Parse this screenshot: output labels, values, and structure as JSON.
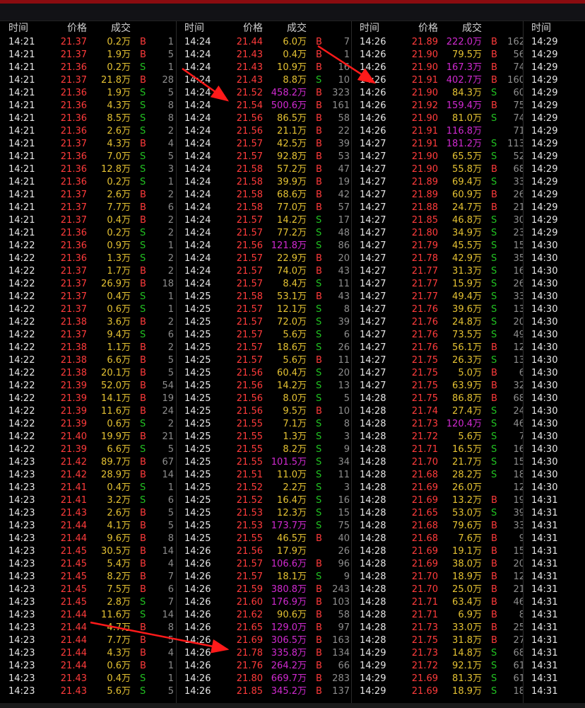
{
  "header": {
    "time": "时间",
    "price": "价格",
    "volume": "成交"
  },
  "colors": {
    "up": "#ff3b3b",
    "down": "#1fbf1f",
    "vol": "#e5c233",
    "vol_big": "#d12ad1",
    "buy": "#ff3b3b",
    "sell": "#22c322",
    "accent_bar": "#8a0c10"
  },
  "columns": [
    {
      "rows": [
        [
          "14:21",
          "21.37",
          "0.2万",
          "B",
          "1"
        ],
        [
          "14:21",
          "21.37",
          "1.9万",
          "B",
          "5"
        ],
        [
          "14:21",
          "21.36",
          "0.2万",
          "S",
          "1"
        ],
        [
          "14:21",
          "21.37",
          "21.8万",
          "B",
          "28"
        ],
        [
          "14:21",
          "21.36",
          "1.9万",
          "S",
          "5"
        ],
        [
          "14:21",
          "21.36",
          "4.3万",
          "S",
          "8"
        ],
        [
          "14:21",
          "21.36",
          "8.5万",
          "S",
          "8"
        ],
        [
          "14:21",
          "21.36",
          "2.6万",
          "S",
          "2"
        ],
        [
          "14:21",
          "21.37",
          "4.3万",
          "B",
          "4"
        ],
        [
          "14:21",
          "21.36",
          "7.0万",
          "S",
          "5"
        ],
        [
          "14:21",
          "21.36",
          "12.8万",
          "S",
          "3"
        ],
        [
          "14:21",
          "21.36",
          "0.2万",
          "S",
          "1"
        ],
        [
          "14:21",
          "21.37",
          "2.6万",
          "B",
          "2"
        ],
        [
          "14:21",
          "21.37",
          "7.7万",
          "B",
          "6"
        ],
        [
          "14:21",
          "21.37",
          "0.4万",
          "B",
          "2"
        ],
        [
          "14:21",
          "21.36",
          "0.2万",
          "S",
          "2"
        ],
        [
          "14:22",
          "21.36",
          "0.9万",
          "S",
          "1"
        ],
        [
          "14:22",
          "21.36",
          "1.3万",
          "S",
          "2"
        ],
        [
          "14:22",
          "21.37",
          "1.7万",
          "B",
          "2"
        ],
        [
          "14:22",
          "21.37",
          "26.9万",
          "B",
          "18"
        ],
        [
          "14:22",
          "21.37",
          "0.4万",
          "S",
          "1"
        ],
        [
          "14:22",
          "21.37",
          "0.6万",
          "S",
          "1"
        ],
        [
          "14:22",
          "21.38",
          "3.6万",
          "B",
          "2"
        ],
        [
          "14:22",
          "21.37",
          "9.4万",
          "S",
          "6"
        ],
        [
          "14:22",
          "21.38",
          "1.1万",
          "B",
          "2"
        ],
        [
          "14:22",
          "21.38",
          "6.6万",
          "B",
          "5"
        ],
        [
          "14:22",
          "21.38",
          "20.1万",
          "B",
          "5"
        ],
        [
          "14:22",
          "21.39",
          "52.0万",
          "B",
          "54"
        ],
        [
          "14:22",
          "21.39",
          "14.1万",
          "B",
          "19"
        ],
        [
          "14:22",
          "21.39",
          "11.6万",
          "B",
          "24"
        ],
        [
          "14:22",
          "21.39",
          "0.6万",
          "S",
          "2"
        ],
        [
          "14:22",
          "21.40",
          "19.9万",
          "B",
          "21"
        ],
        [
          "14:22",
          "21.39",
          "6.6万",
          "S",
          "5"
        ],
        [
          "14:23",
          "21.42",
          "89.7万",
          "B",
          "67"
        ],
        [
          "14:23",
          "21.42",
          "28.9万",
          "B",
          "14"
        ],
        [
          "14:23",
          "21.41",
          "0.4万",
          "S",
          "1"
        ],
        [
          "14:23",
          "21.41",
          "3.2万",
          "S",
          "6"
        ],
        [
          "14:23",
          "21.43",
          "2.6万",
          "B",
          "5"
        ],
        [
          "14:23",
          "21.44",
          "4.1万",
          "B",
          "5"
        ],
        [
          "14:23",
          "21.44",
          "9.6万",
          "B",
          "8"
        ],
        [
          "14:23",
          "21.45",
          "30.5万",
          "B",
          "14"
        ],
        [
          "14:23",
          "21.45",
          "5.4万",
          "B",
          "4"
        ],
        [
          "14:23",
          "21.45",
          "8.2万",
          "B",
          "7"
        ],
        [
          "14:23",
          "21.45",
          "7.5万",
          "B",
          "6"
        ],
        [
          "14:23",
          "21.45",
          "2.8万",
          "S",
          "7"
        ],
        [
          "14:23",
          "21.44",
          "11.6万",
          "S",
          "14"
        ],
        [
          "14:23",
          "21.44",
          "4.7万",
          "B",
          "8"
        ],
        [
          "14:23",
          "21.44",
          "7.7万",
          "B",
          "5"
        ],
        [
          "14:23",
          "21.44",
          "4.3万",
          "B",
          "4"
        ],
        [
          "14:23",
          "21.44",
          "0.6万",
          "B",
          "1"
        ],
        [
          "14:23",
          "21.43",
          "0.4万",
          "S",
          "1"
        ],
        [
          "14:23",
          "21.43",
          "5.6万",
          "S",
          "5"
        ]
      ]
    },
    {
      "rows": [
        [
          "14:24",
          "21.44",
          "6.0万",
          "B",
          "7"
        ],
        [
          "14:24",
          "21.43",
          "0.4万",
          "B",
          "1"
        ],
        [
          "14:24",
          "21.43",
          "10.9万",
          "B",
          "16"
        ],
        [
          "14:24",
          "21.43",
          "8.8万",
          "S",
          "10"
        ],
        [
          "14:24",
          "21.52",
          "458.2万",
          "B",
          "323"
        ],
        [
          "14:24",
          "21.54",
          "500.6万",
          "B",
          "161"
        ],
        [
          "14:24",
          "21.56",
          "86.5万",
          "B",
          "58"
        ],
        [
          "14:24",
          "21.56",
          "21.1万",
          "B",
          "22"
        ],
        [
          "14:24",
          "21.57",
          "42.5万",
          "B",
          "39"
        ],
        [
          "14:24",
          "21.57",
          "92.8万",
          "B",
          "53"
        ],
        [
          "14:24",
          "21.58",
          "57.2万",
          "B",
          "47"
        ],
        [
          "14:24",
          "21.58",
          "39.9万",
          "B",
          "19"
        ],
        [
          "14:24",
          "21.58",
          "68.6万",
          "B",
          "42"
        ],
        [
          "14:24",
          "21.58",
          "77.0万",
          "B",
          "57"
        ],
        [
          "14:24",
          "21.57",
          "14.2万",
          "S",
          "17"
        ],
        [
          "14:24",
          "21.57",
          "77.2万",
          "S",
          "48"
        ],
        [
          "14:24",
          "21.56",
          "121.8万",
          "S",
          "86"
        ],
        [
          "14:24",
          "21.57",
          "22.9万",
          "B",
          "20"
        ],
        [
          "14:24",
          "21.57",
          "74.0万",
          "B",
          "43"
        ],
        [
          "14:24",
          "21.57",
          "8.4万",
          "S",
          "11"
        ],
        [
          "14:25",
          "21.58",
          "53.1万",
          "B",
          "43"
        ],
        [
          "14:25",
          "21.57",
          "12.1万",
          "S",
          "8"
        ],
        [
          "14:25",
          "21.57",
          "72.0万",
          "S",
          "39"
        ],
        [
          "14:25",
          "21.57",
          "5.6万",
          "S",
          "6"
        ],
        [
          "14:25",
          "21.57",
          "18.6万",
          "S",
          "26"
        ],
        [
          "14:25",
          "21.57",
          "5.6万",
          "B",
          "11"
        ],
        [
          "14:25",
          "21.56",
          "60.4万",
          "S",
          "20"
        ],
        [
          "14:25",
          "21.56",
          "14.2万",
          "S",
          "13"
        ],
        [
          "14:25",
          "21.56",
          "8.0万",
          "S",
          "5"
        ],
        [
          "14:25",
          "21.56",
          "9.5万",
          "B",
          "10"
        ],
        [
          "14:25",
          "21.55",
          "7.1万",
          "S",
          "8"
        ],
        [
          "14:25",
          "21.55",
          "1.3万",
          "S",
          "3"
        ],
        [
          "14:25",
          "21.55",
          "8.2万",
          "S",
          "9"
        ],
        [
          "14:25",
          "21.55",
          "101.5万",
          "S",
          "34"
        ],
        [
          "14:25",
          "21.51",
          "11.0万",
          "S",
          "11"
        ],
        [
          "14:25",
          "21.52",
          "2.2万",
          "S",
          "3"
        ],
        [
          "14:25",
          "21.52",
          "16.4万",
          "S",
          "16"
        ],
        [
          "14:25",
          "21.53",
          "12.3万",
          "S",
          "15"
        ],
        [
          "14:25",
          "21.53",
          "173.7万",
          "S",
          "75"
        ],
        [
          "14:25",
          "21.55",
          "46.5万",
          "B",
          "40"
        ],
        [
          "14:26",
          "21.56",
          "17.9万",
          "",
          "26"
        ],
        [
          "14:26",
          "21.57",
          "106.6万",
          "B",
          "96"
        ],
        [
          "14:26",
          "21.57",
          "18.1万",
          "S",
          "9"
        ],
        [
          "14:26",
          "21.59",
          "380.8万",
          "B",
          "243"
        ],
        [
          "14:26",
          "21.60",
          "176.9万",
          "B",
          "103"
        ],
        [
          "14:26",
          "21.62",
          "90.6万",
          "B",
          "58"
        ],
        [
          "14:26",
          "21.65",
          "129.0万",
          "B",
          "97"
        ],
        [
          "14:26",
          "21.69",
          "306.5万",
          "B",
          "163"
        ],
        [
          "14:26",
          "21.78",
          "335.8万",
          "B",
          "134"
        ],
        [
          "14:26",
          "21.76",
          "264.2万",
          "B",
          "66"
        ],
        [
          "14:26",
          "21.80",
          "669.7万",
          "B",
          "283"
        ],
        [
          "14:26",
          "21.85",
          "345.2万",
          "B",
          "137"
        ]
      ]
    },
    {
      "rows": [
        [
          "14:26",
          "21.89",
          "222.0万",
          "B",
          "162"
        ],
        [
          "14:26",
          "21.90",
          "79.5万",
          "B",
          "56"
        ],
        [
          "14:26",
          "21.90",
          "167.3万",
          "B",
          "74"
        ],
        [
          "14:26",
          "21.91",
          "402.7万",
          "B",
          "160"
        ],
        [
          "14:26",
          "21.90",
          "84.3万",
          "S",
          "60"
        ],
        [
          "14:26",
          "21.92",
          "159.4万",
          "B",
          "75"
        ],
        [
          "14:26",
          "21.90",
          "81.0万",
          "S",
          "74"
        ],
        [
          "14:26",
          "21.91",
          "116.8万",
          "",
          "71"
        ],
        [
          "14:27",
          "21.91",
          "181.2万",
          "S",
          "113"
        ],
        [
          "14:27",
          "21.90",
          "65.5万",
          "S",
          "52"
        ],
        [
          "14:27",
          "21.90",
          "55.8万",
          "B",
          "68"
        ],
        [
          "14:27",
          "21.89",
          "69.4万",
          "S",
          "33"
        ],
        [
          "14:27",
          "21.89",
          "60.9万",
          "B",
          "26"
        ],
        [
          "14:27",
          "21.88",
          "24.7万",
          "B",
          "21"
        ],
        [
          "14:27",
          "21.85",
          "46.8万",
          "S",
          "30"
        ],
        [
          "14:27",
          "21.80",
          "34.9万",
          "S",
          "23"
        ],
        [
          "14:27",
          "21.79",
          "45.5万",
          "S",
          "15"
        ],
        [
          "14:27",
          "21.78",
          "42.9万",
          "S",
          "35"
        ],
        [
          "14:27",
          "21.77",
          "31.3万",
          "S",
          "16"
        ],
        [
          "14:27",
          "21.77",
          "15.9万",
          "S",
          "26"
        ],
        [
          "14:27",
          "21.77",
          "49.4万",
          "S",
          "33"
        ],
        [
          "14:27",
          "21.76",
          "39.6万",
          "S",
          "13"
        ],
        [
          "14:27",
          "21.76",
          "24.8万",
          "S",
          "20"
        ],
        [
          "14:27",
          "21.76",
          "73.5万",
          "S",
          "49"
        ],
        [
          "14:27",
          "21.76",
          "56.1万",
          "B",
          "12"
        ],
        [
          "14:27",
          "21.75",
          "26.3万",
          "S",
          "13"
        ],
        [
          "14:27",
          "21.75",
          "5.0万",
          "B",
          "6"
        ],
        [
          "14:27",
          "21.75",
          "63.9万",
          "B",
          "32"
        ],
        [
          "14:28",
          "21.75",
          "86.8万",
          "B",
          "68"
        ],
        [
          "14:28",
          "21.74",
          "27.4万",
          "S",
          "24"
        ],
        [
          "14:28",
          "21.73",
          "120.4万",
          "S",
          "46"
        ],
        [
          "14:28",
          "21.72",
          "5.6万",
          "S",
          "7"
        ],
        [
          "14:28",
          "21.71",
          "16.5万",
          "S",
          "16"
        ],
        [
          "14:28",
          "21.70",
          "21.7万",
          "S",
          "15"
        ],
        [
          "14:28",
          "21.68",
          "28.2万",
          "S",
          "18"
        ],
        [
          "14:28",
          "21.69",
          "26.0万",
          "",
          "12"
        ],
        [
          "14:28",
          "21.69",
          "13.2万",
          "B",
          "19"
        ],
        [
          "14:28",
          "21.65",
          "53.0万",
          "S",
          "39"
        ],
        [
          "14:28",
          "21.68",
          "79.6万",
          "B",
          "33"
        ],
        [
          "14:28",
          "21.68",
          "7.6万",
          "B",
          "9"
        ],
        [
          "14:28",
          "21.69",
          "19.1万",
          "B",
          "15"
        ],
        [
          "14:28",
          "21.69",
          "38.0万",
          "B",
          "20"
        ],
        [
          "14:28",
          "21.70",
          "18.9万",
          "B",
          "12"
        ],
        [
          "14:28",
          "21.70",
          "25.0万",
          "B",
          "21"
        ],
        [
          "14:28",
          "21.71",
          "63.4万",
          "B",
          "46"
        ],
        [
          "14:28",
          "21.71",
          "6.9万",
          "B",
          "8"
        ],
        [
          "14:28",
          "21.73",
          "33.0万",
          "B",
          "25"
        ],
        [
          "14:28",
          "21.75",
          "31.8万",
          "B",
          "27"
        ],
        [
          "14:29",
          "21.73",
          "14.8万",
          "S",
          "68"
        ],
        [
          "14:29",
          "21.72",
          "92.1万",
          "S",
          "61"
        ],
        [
          "14:29",
          "21.69",
          "81.3万",
          "S",
          "61"
        ],
        [
          "14:29",
          "21.69",
          "18.9万",
          "S",
          "18"
        ]
      ]
    },
    {
      "rows": [
        [
          "14:29"
        ],
        [
          "14:29"
        ],
        [
          "14:29"
        ],
        [
          "14:29"
        ],
        [
          "14:29"
        ],
        [
          "14:29"
        ],
        [
          "14:29"
        ],
        [
          "14:29"
        ],
        [
          "14:29"
        ],
        [
          "14:29"
        ],
        [
          "14:29"
        ],
        [
          "14:29"
        ],
        [
          "14:29"
        ],
        [
          "14:29"
        ],
        [
          "14:29"
        ],
        [
          "14:29"
        ],
        [
          "14:30"
        ],
        [
          "14:30"
        ],
        [
          "14:30"
        ],
        [
          "14:30"
        ],
        [
          "14:30"
        ],
        [
          "14:30"
        ],
        [
          "14:30"
        ],
        [
          "14:30"
        ],
        [
          "14:30"
        ],
        [
          "14:30"
        ],
        [
          "14:30"
        ],
        [
          "14:30"
        ],
        [
          "14:30"
        ],
        [
          "14:30"
        ],
        [
          "14:30"
        ],
        [
          "14:30"
        ],
        [
          "14:30"
        ],
        [
          "14:30"
        ],
        [
          "14:30"
        ],
        [
          "14:30"
        ],
        [
          "14:31"
        ],
        [
          "14:31"
        ],
        [
          "14:31"
        ],
        [
          "14:31"
        ],
        [
          "14:31"
        ],
        [
          "14:31"
        ],
        [
          "14:31"
        ],
        [
          "14:31"
        ],
        [
          "14:31"
        ],
        [
          "14:31"
        ],
        [
          "14:31"
        ],
        [
          "14:31"
        ],
        [
          "14:31"
        ],
        [
          "14:31"
        ],
        [
          "14:31"
        ],
        [
          "14:31"
        ]
      ]
    }
  ]
}
